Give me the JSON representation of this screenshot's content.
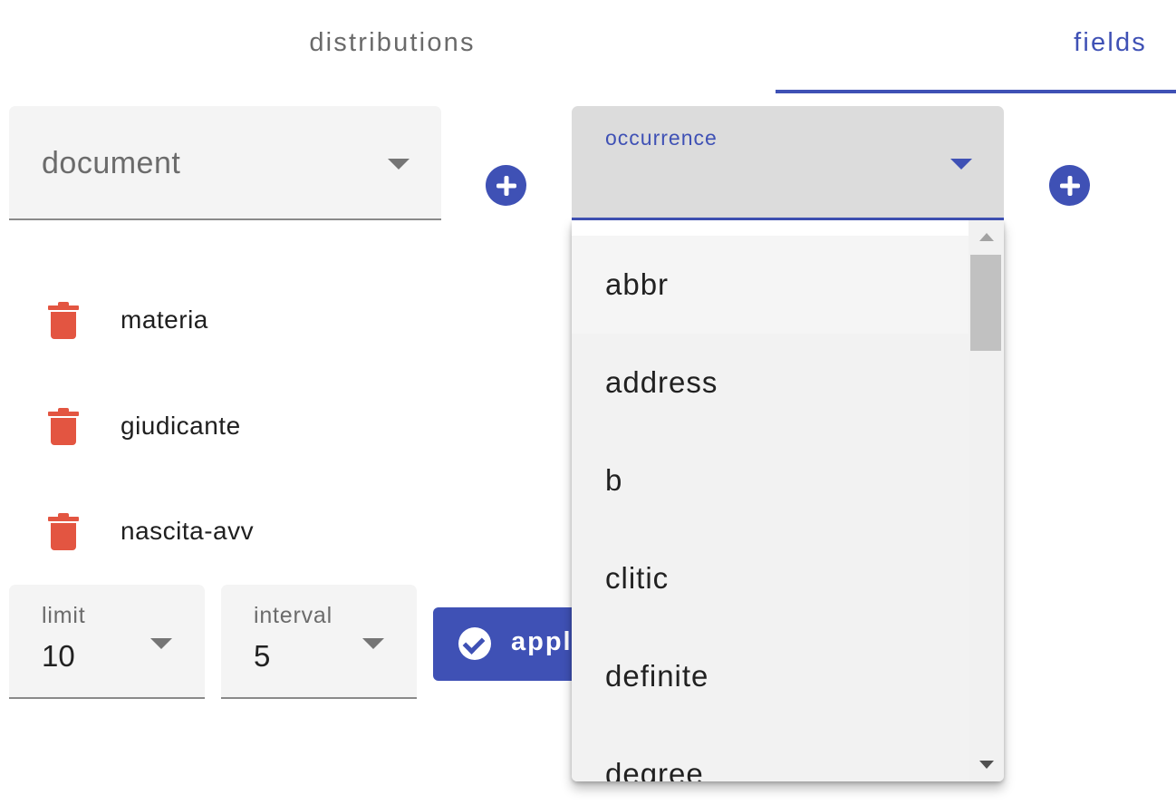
{
  "tabs": {
    "distributions": "distributions",
    "fields": "fields",
    "active": "fields"
  },
  "document_select": {
    "value": "document"
  },
  "occurrence_select": {
    "label": "occurrence",
    "value": ""
  },
  "fields": [
    {
      "name": "materia"
    },
    {
      "name": "giudicante"
    },
    {
      "name": "nascita-avv"
    }
  ],
  "limit": {
    "label": "limit",
    "value": "10"
  },
  "interval": {
    "label": "interval",
    "value": "5"
  },
  "apply_button": {
    "label": "apply"
  },
  "occurrence_menu": {
    "items": [
      "abbr",
      "address",
      "b",
      "clitic",
      "definite",
      "degree"
    ]
  },
  "icons": {
    "add": "plus-circle-icon",
    "delete": "trash-icon",
    "apply": "check-circle-icon",
    "dropdown": "caret-down-icon"
  },
  "colors": {
    "primary": "#3f51b5",
    "delete": "#e35541",
    "field_bg": "#f4f4f4"
  }
}
